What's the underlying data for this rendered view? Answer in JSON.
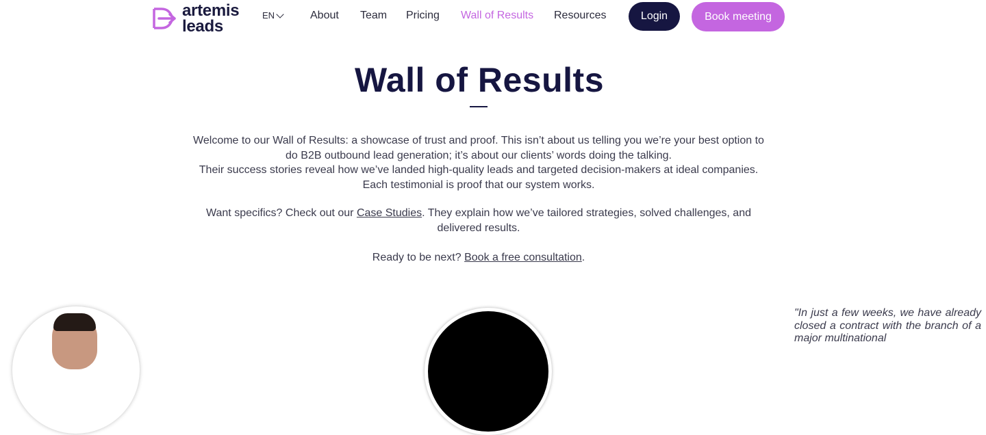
{
  "header": {
    "logo_line1": "artemis",
    "logo_line2": "leads",
    "language": "EN",
    "nav": [
      "About",
      "Team",
      "Pricing",
      "Wall of Results",
      "Resources"
    ],
    "active_nav": "Wall of Results",
    "login_label": "Login",
    "book_label": "Book meeting"
  },
  "colors": {
    "brand_purple": "#c466e0",
    "navy": "#161641"
  },
  "main": {
    "title": "Wall of Results",
    "intro_line1": "Welcome to our Wall of Results: a showcase of trust and proof. This isn’t about us telling you we’re your best option to do B2B outbound lead generation; it’s about our clients’ words doing the talking.",
    "intro_line2": "Their success stories reveal how we’ve landed high-quality leads and targeted decision-makers at ideal companies. Each testimonial is proof that our system works.",
    "specifics_before": "Want specifics? Check out our ",
    "specifics_link": "Case Studies",
    "specifics_after": ". They explain how we’ve tailored strategies, solved challenges, and delivered results.",
    "ready_before": "Ready to be next? ",
    "ready_link": "Book a free consultation",
    "ready_after": "."
  },
  "testimonials": {
    "quote_text": "\"In just a few weeks, we have already closed a contract with the branch of a major multinational"
  }
}
